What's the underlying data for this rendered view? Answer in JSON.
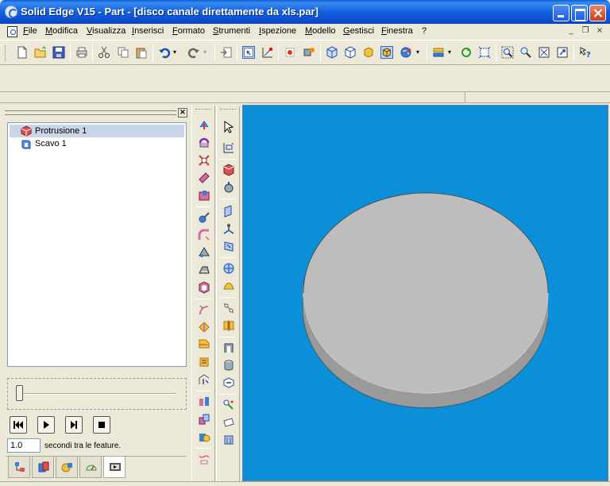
{
  "window": {
    "title": "Solid Edge V15 - Part - [disco canale direttamente da xls.par]",
    "app_icon": "solid-edge-app-icon"
  },
  "menu": {
    "items": [
      "File",
      "Modifica",
      "Visualizza",
      "Inserisci",
      "Formato",
      "Strumenti",
      "Ispezione",
      "Modello",
      "Gestisci",
      "Finestra",
      "?"
    ],
    "mdi_minimize": "_",
    "mdi_restore": "❐",
    "mdi_close": "×"
  },
  "toolbar": {
    "icons": [
      "new-file-icon",
      "open-folder-icon",
      "save-disk-icon",
      "print-icon",
      "cut-icon",
      "copy-icon",
      "paste-icon",
      "undo-icon",
      "redo-icon",
      "insert-icon",
      "select-tool-icon",
      "sketch-icon",
      "paint-icon",
      "render-icon",
      "iso-view-icon",
      "front-view-icon",
      "shaded-icon",
      "shaded-edges-icon",
      "globe-icon",
      "layers-icon",
      "rotate-icon",
      "fit-icon",
      "zoom-area-icon",
      "zoom-icon",
      "fit-all-icon",
      "pan-icon",
      "whats-this-icon"
    ]
  },
  "feature_tree": {
    "items": [
      {
        "label": "Protrusione 1",
        "icon": "protrusion-icon",
        "selected": true
      },
      {
        "label": "Scavo 1",
        "icon": "cutout-icon",
        "selected": false
      }
    ]
  },
  "playback": {
    "controls": [
      "rewind-icon",
      "play-icon",
      "step-icon",
      "stop-icon"
    ],
    "seconds_value": "1.0",
    "seconds_label": "secondi tra le feature."
  },
  "pane_tabs": [
    "feature-pathfinder-tab",
    "family-of-parts-tab",
    "assembly-tab",
    "sensors-tab",
    "feature-playback-tab"
  ],
  "colors": {
    "viewport_background": "#0a8fd8",
    "disk_top": "#bdbdbd",
    "disk_side": "#9a9a9a",
    "accent": "#0b4fd0"
  }
}
